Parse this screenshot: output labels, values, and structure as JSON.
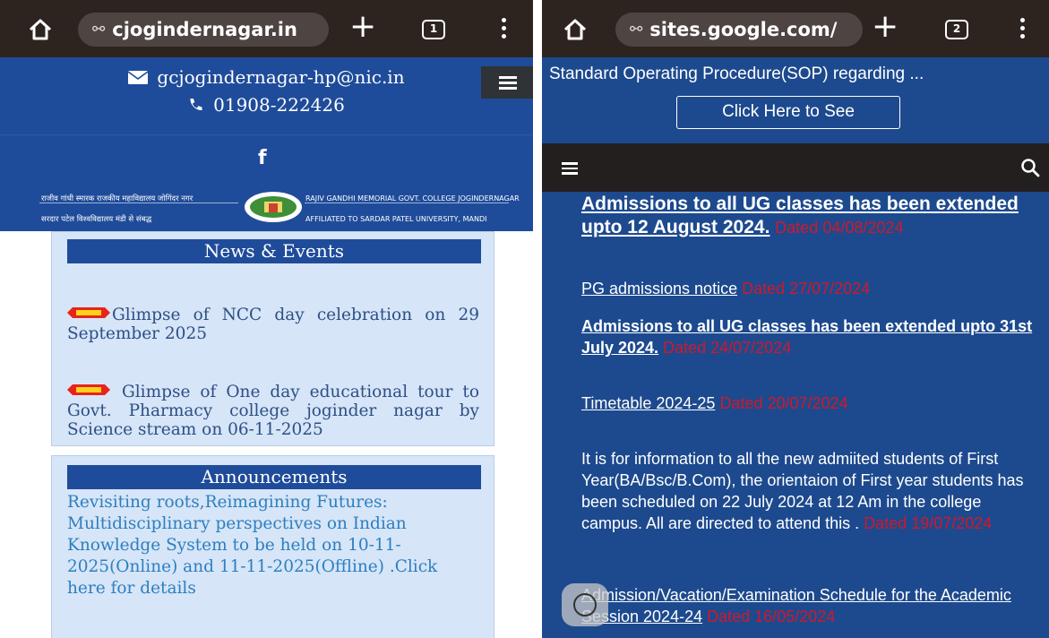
{
  "left": {
    "browser": {
      "url": "cjogindernagar.in",
      "tab_count": "1"
    },
    "contact": {
      "email": "gcjogindernagar-hp@nic.in",
      "phone": "01908-222426"
    },
    "facebook_glyph": "f",
    "banner": {
      "hindi_line1": "राजीव गांधी स्मारक राजकीय महाविद्यालय जोगिंदर नगर",
      "hindi_line2": "सरदार पटेल विश्वविद्यालय मंडी से संबद्ध",
      "english_line1": "RAJIV GANDHI MEMORIAL GOVT. COLLEGE JOGINDERNAGAR",
      "english_line2": "AFFILIATED TO SARDAR PATEL UNIVERSITY, MANDI"
    },
    "news": {
      "title": "News & Events",
      "items": [
        "Glimpse of NCC day celebration on 29 September 2025",
        "Glimpse of One day educational tour to Govt. Pharmacy college joginder nagar by Science stream on 06-11-2025"
      ]
    },
    "announcements": {
      "title": "Announcements",
      "text": "Revisiting roots,Reimagining Futures: Multidisciplinary perspectives on Indian Knowledge System to be held on 10-11-2025(Online) and 11-11-2025(Offline) .Click here for details"
    },
    "colors": {
      "primary_blue": "#1f4c9a",
      "panel_bg": "#d6e5f7",
      "chrome": "#2d2420"
    }
  },
  "right": {
    "browser": {
      "url": "sites.google.com/",
      "tab_count": "2"
    },
    "sop_text": "Standard Operating Procedure(SOP) regarding ...",
    "sop_button": "Click Here to See",
    "items": [
      {
        "text": "Admissions to all UG classes has been extended upto  12 August 2024.",
        "dated": "Dated 04/08/2024"
      },
      {
        "text": "PG admissions notice",
        "dated": "Dated 27/07/2024"
      },
      {
        "text": "Admissions to all UG classes has been extended upto 31st July 2024.",
        "dated": "Dated 24/07/2024"
      },
      {
        "text": "Timetable 2024-25",
        "dated": "Dated 20/07/2024"
      },
      {
        "text": "It is for information to all the new admiited students of First Year(BA/Bsc/B.Com), the orientaion of First year students has been scheduled on 22 July 2024 at 12 Am in the college campus. All are directed to attend this .",
        "dated": "Dated 19/07/2024"
      },
      {
        "text": "Admission/Vacation/Examination Schedule for the Academic Session 2024-24",
        "dated": "Dated 16/05/2024"
      }
    ],
    "colors": {
      "background": "#1d4a8e",
      "dated_red": "#d0182b",
      "nav_dark": "#231f1e"
    }
  }
}
